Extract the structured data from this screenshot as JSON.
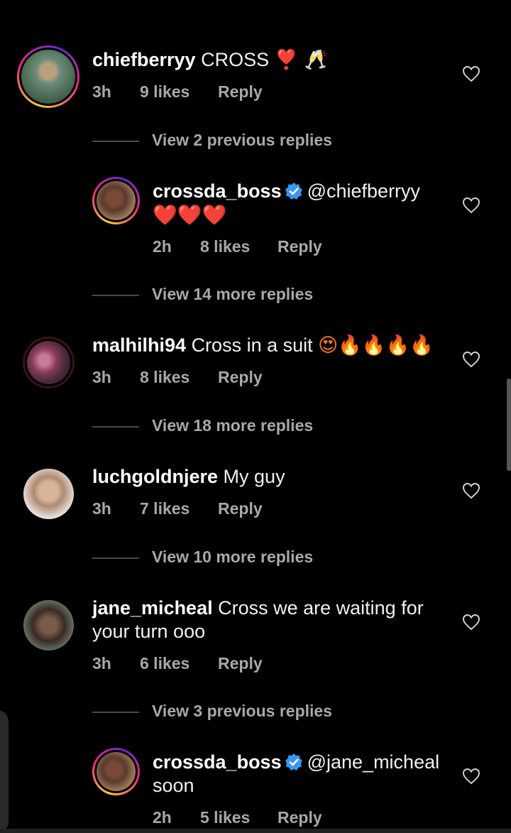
{
  "comments": [
    {
      "username": "chiefberryy",
      "text": "CROSS",
      "emoji": "❣️ 🥂",
      "time": "3h",
      "likes": "9 likes",
      "reply": "Reply"
    },
    {
      "view_replies": "View 2 previous replies"
    },
    {
      "username": "crossda_boss",
      "mention": "@chiefberryy",
      "text_line2": "❤️❤️❤️",
      "time": "2h",
      "likes": "8 likes",
      "reply": "Reply"
    },
    {
      "view_replies": "View 14 more replies"
    },
    {
      "username": "malhilhi94",
      "text": "Cross in a suit",
      "emoji": "😍🔥🔥🔥🔥",
      "time": "3h",
      "likes": "8 likes",
      "reply": "Reply"
    },
    {
      "view_replies": "View 18 more replies"
    },
    {
      "username": "luchgoldnjere",
      "text": "My guy",
      "time": "3h",
      "likes": "7 likes",
      "reply": "Reply"
    },
    {
      "view_replies": "View 10 more replies"
    },
    {
      "username": "jane_micheal",
      "text": "Cross we are waiting for",
      "text_line2": "your turn ooo",
      "time": "3h",
      "likes": "6 likes",
      "reply": "Reply"
    },
    {
      "view_replies": "View 3 previous replies"
    },
    {
      "username": "crossda_boss",
      "mention": "@jane_micheal",
      "text_line2": "soon",
      "time": "2h",
      "likes": "5 likes",
      "reply": "Reply"
    }
  ],
  "colors": {
    "background": "#000000",
    "secondary_text": "#a8a8a8",
    "verified": "#3897f0"
  }
}
